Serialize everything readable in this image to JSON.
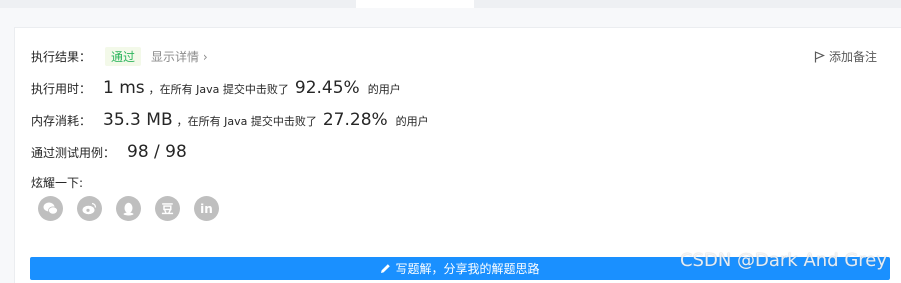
{
  "result": {
    "label": "执行结果：",
    "status": "通过",
    "detail_link": "显示详情 ›",
    "add_note": "添加备注"
  },
  "runtime": {
    "label": "执行用时：",
    "value": "1 ms",
    "middle": "，在所有 Java 提交中击败了",
    "percent": "92.45%",
    "suffix": "的用户"
  },
  "memory": {
    "label": "内存消耗：",
    "value": "35.3 MB",
    "middle": "，在所有 Java 提交中击败了",
    "percent": "27.28%",
    "suffix": "的用户"
  },
  "testcases": {
    "label": "通过测试用例：",
    "value": "98 / 98"
  },
  "share": {
    "label": "炫耀一下:",
    "icons": [
      "wechat-icon",
      "weibo-icon",
      "qq-icon",
      "douban-icon",
      "linkedin-icon"
    ],
    "douban_glyph": "豆",
    "linkedin_glyph": "in"
  },
  "solution_button": {
    "label": "写题解，分享我的解题思路"
  },
  "watermark": "CSDN @Dark And Grey",
  "colors": {
    "accent": "#1a90ff",
    "pass": "#2db55d",
    "icon_gray": "#bfbfbf"
  }
}
